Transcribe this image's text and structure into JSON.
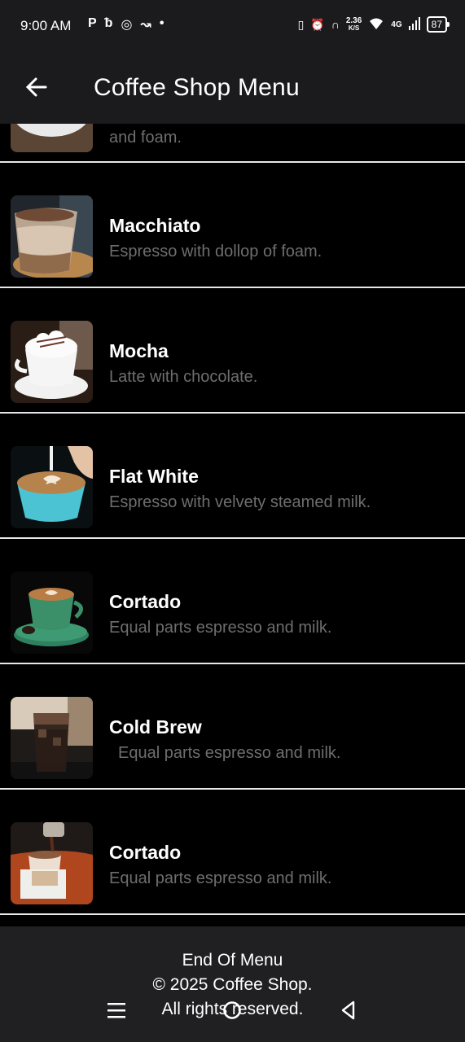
{
  "status_bar": {
    "time": "9:00 AM",
    "left_icons": [
      "p-icon",
      "b-icon",
      "whatsapp-icon",
      "missed-call-icon",
      "dot-icon"
    ],
    "speed_value": "2.36",
    "speed_unit": "K/S",
    "network": "4G",
    "battery": "87"
  },
  "app_bar": {
    "title": "Coffee Shop Menu"
  },
  "menu": {
    "partial_desc": "and foam.",
    "items": [
      {
        "name": "Macchiato",
        "desc": "Espresso with dollop of foam.",
        "image": "macchiato-image"
      },
      {
        "name": "Mocha",
        "desc": "Latte with chocolate.",
        "image": "mocha-image"
      },
      {
        "name": "Flat White",
        "desc": "Espresso with velvety steamed milk.",
        "image": "flat-white-image"
      },
      {
        "name": "Cortado",
        "desc": "Equal parts espresso and milk.",
        "image": "cortado-image"
      },
      {
        "name": "Cold Brew",
        "desc": "Equal parts espresso and milk.",
        "image": "cold-brew-image"
      },
      {
        "name": "Cortado",
        "desc": "Equal parts espresso and milk.",
        "image": "cortado-pour-image"
      }
    ]
  },
  "footer": {
    "line1": "End Of Menu",
    "line2": "© 2025 Coffee Shop.",
    "line3": "All rights reserved."
  },
  "nav_bar": {
    "icons": [
      "menu-icon",
      "home-circle-icon",
      "back-triangle-icon"
    ]
  }
}
